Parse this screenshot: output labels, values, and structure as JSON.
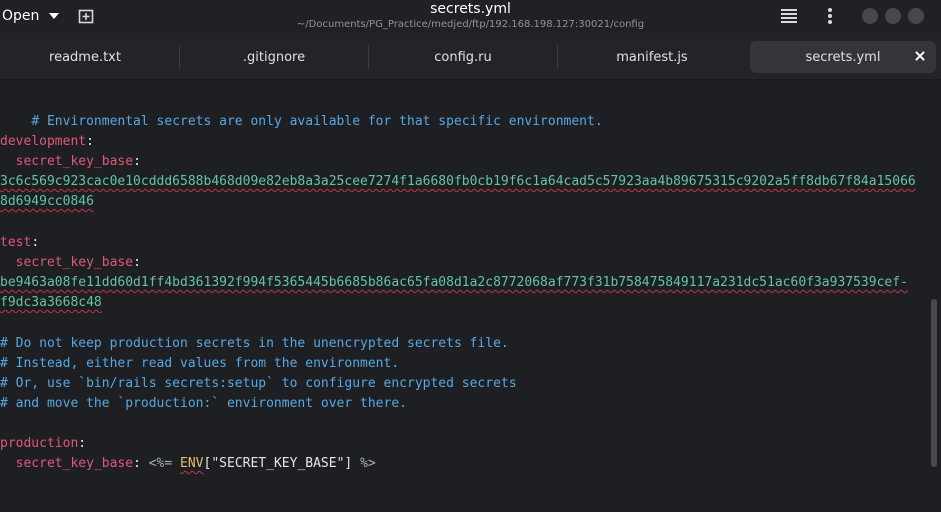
{
  "header": {
    "open_label": "Open",
    "title": "secrets.yml",
    "path": "~/Documents/PG_Practice/medjed/ftp/192.168.198.127:30021/config",
    "icons": [
      "chevron-down-icon",
      "new-tab-icon",
      "hamburger-menu-icon",
      "kebab-menu-icon",
      "minimize-icon",
      "maximize-icon"
    ]
  },
  "tabs": [
    {
      "label": "readme.txt"
    },
    {
      "label": ".gitignore"
    },
    {
      "label": "config.ru"
    },
    {
      "label": "manifest.js"
    },
    {
      "label": "secrets.yml"
    }
  ],
  "editor": {
    "comment_1": "# Environmental secrets are only available for that specific environment.",
    "development_key": "development",
    "development_sub": "secret_key_base",
    "development_hex_1": "3c6c569c923cac0e10cddd6588b468d09e82eb8a3a25cee7274f1a6680fb0cb19f6c1a64cad5c57923aa4b89675315c9202a5ff8db67f84a15066",
    "development_hex_2": "8d6949cc0846",
    "test_key": "test",
    "test_sub": "secret_key_base",
    "test_hex_1": "be9463a08fe11dd60d1ff4bd361392f994f5365445b6685b86ac65fa08d1a2c8772068af773f31b758475849117a231dc51ac60f3a937539cef-",
    "test_hex_2": "f9dc3a3668c48",
    "comment_2": "# Do not keep production secrets in the unencrypted secrets file.",
    "comment_3": "# Instead, either read values from the environment.",
    "comment_4": "# Or, use `bin/rails secrets:setup` to configure encrypted secrets",
    "comment_5": "# and move the `production:` environment over there.",
    "production_key": "production",
    "production_sub": "secret_key_base",
    "erb_open": "<%=",
    "env_name": "ENV",
    "env_arg": "[\"SECRET_KEY_BASE\"]",
    "erb_close": "%>",
    "colon": ":",
    "indent": "  "
  }
}
